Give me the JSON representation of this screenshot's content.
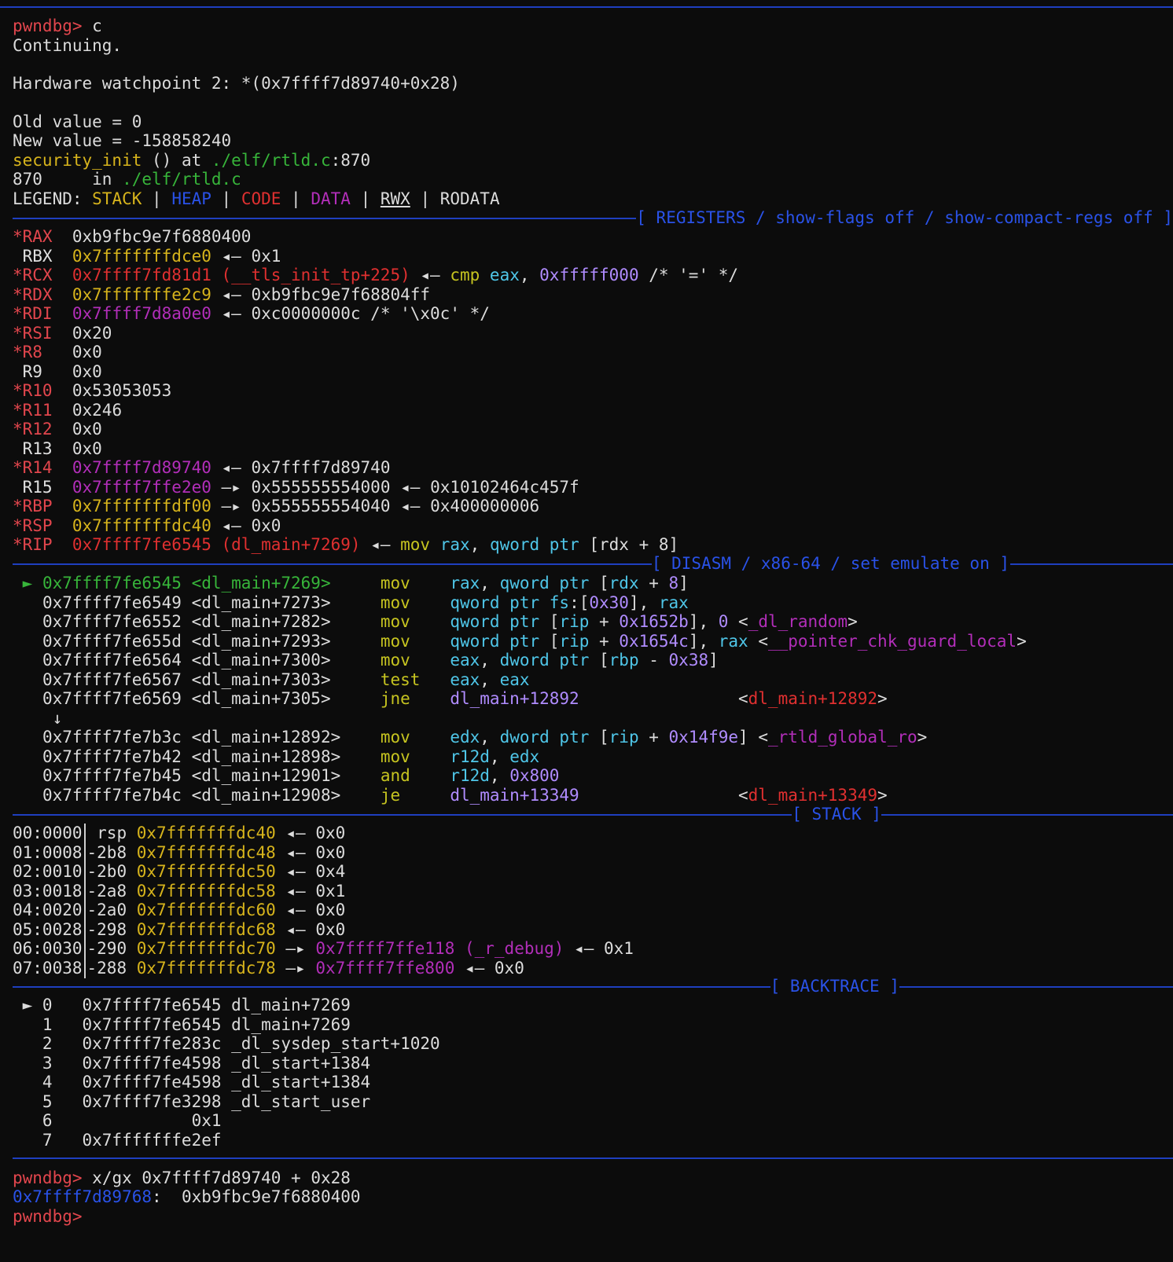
{
  "prompt": "pwndbg>",
  "session": {
    "cmd1": "c",
    "continuing": "Continuing.",
    "watch": "Hardware watchpoint 2: *(0x7ffff7d89740+0x28)",
    "old_value": "Old value = 0",
    "new_value": "New value = -158858240",
    "func": "security_init",
    "func_mid": " () at ",
    "file": "./elf/rtld.c",
    "file_line": ":870",
    "src_line_no": "870     in ",
    "legend": {
      "label": "LEGEND: ",
      "stack": "STACK",
      "heap": "HEAP",
      "code": "CODE",
      "data": "DATA",
      "rwx": "RWX",
      "rodata": "RODATA",
      "sep": " | "
    }
  },
  "headers": {
    "registers": "[ REGISTERS / show-flags off / show-compact-regs off ]",
    "disasm": "[ DISASM / x86-64 / set emulate on ]",
    "stack": "[ STACK ]",
    "backtrace": "[ BACKTRACE ]"
  },
  "registers": {
    "rax": {
      "name": "*RAX",
      "val": "0xb9fbc9e7f6880400"
    },
    "rbx": {
      "name": " RBX",
      "val": "0x7fffffffdce0",
      "arrow": " ◂— ",
      "deref": "0x1"
    },
    "rcx": {
      "name": "*RCX",
      "val": "0x7ffff7fd81d1 (__tls_init_tp+225)",
      "arrow": " ◂— ",
      "ins": "cmp",
      "a1": "eax",
      "a2": "0xfffff000",
      "cmt": " /* '=' */"
    },
    "rdx": {
      "name": "*RDX",
      "val": "0x7fffffffe2c9",
      "arrow": " ◂— ",
      "deref": "0xb9fbc9e7f68804ff"
    },
    "rdi": {
      "name": "*RDI",
      "val": "0x7ffff7d8a0e0",
      "arrow": " ◂— ",
      "deref": "0xc0000000c /* '\\x0c' */"
    },
    "rsi": {
      "name": "*RSI",
      "val": "0x20"
    },
    "r8": {
      "name": "*R8",
      "val": "0x0"
    },
    "r9": {
      "name": " R9",
      "val": "0x0"
    },
    "r10": {
      "name": "*R10",
      "val": "0x53053053"
    },
    "r11": {
      "name": "*R11",
      "val": "0x246"
    },
    "r12": {
      "name": "*R12",
      "val": "0x0"
    },
    "r13": {
      "name": " R13",
      "val": "0x0"
    },
    "r14": {
      "name": "*R14",
      "val": "0x7ffff7d89740",
      "arrow": " ◂— ",
      "deref": "0x7ffff7d89740"
    },
    "r15": {
      "name": " R15",
      "val": "0x7ffff7ffe2e0",
      "arrow": " —▸ ",
      "deref": "0x555555554000",
      "arrow2": " ◂— ",
      "deref2": "0x10102464c457f"
    },
    "rbp": {
      "name": "*RBP",
      "val": "0x7fffffffdf00",
      "arrow": " —▸ ",
      "deref": "0x555555554040",
      "arrow2": " ◂— ",
      "deref2": "0x400000006"
    },
    "rsp": {
      "name": "*RSP",
      "val": "0x7fffffffdc40",
      "arrow": " ◂— ",
      "deref": "0x0"
    },
    "rip": {
      "name": "*RIP",
      "val": "0x7ffff7fe6545 (dl_main+7269)",
      "arrow": " ◂— ",
      "ins": "mov",
      "a1": "rax",
      "a2": "qword ptr",
      "a3": " [rdx + 8]"
    }
  },
  "disasm": [
    {
      "marker": " ► ",
      "addr": "0x7ffff7fe6545 <dl_main+7269>",
      "mn": "mov",
      "ops": "rax, qword ptr [rdx + 8]"
    },
    {
      "marker": "   ",
      "addr": "0x7ffff7fe6549 <dl_main+7273>",
      "mn": "mov",
      "ops": "qword ptr fs:[0x30], rax"
    },
    {
      "marker": "   ",
      "addr": "0x7ffff7fe6552 <dl_main+7282>",
      "mn": "mov",
      "ops": "qword ptr [rip + 0x1652b], 0",
      "sym": "<_dl_random>"
    },
    {
      "marker": "   ",
      "addr": "0x7ffff7fe655d <dl_main+7293>",
      "mn": "mov",
      "ops": "qword ptr [rip + 0x1654c], rax",
      "sym": "<__pointer_chk_guard_local>"
    },
    {
      "marker": "   ",
      "addr": "0x7ffff7fe6564 <dl_main+7300>",
      "mn": "mov",
      "ops": "eax, dword ptr [rbp - 0x38]"
    },
    {
      "marker": "   ",
      "addr": "0x7ffff7fe6567 <dl_main+7303>",
      "mn": "test",
      "ops": "eax, eax"
    },
    {
      "marker": "   ",
      "addr": "0x7ffff7fe6569 <dl_main+7305>",
      "mn": "jne",
      "ops": "dl_main+12892",
      "sym": "<dl_main+12892>"
    },
    {
      "marker": "    ↓",
      "addr": "",
      "mn": "",
      "ops": ""
    },
    {
      "marker": "   ",
      "addr": "0x7ffff7fe7b3c <dl_main+12892>",
      "mn": "mov",
      "ops": "edx, dword ptr [rip + 0x14f9e]",
      "sym": "<_rtld_global_ro>"
    },
    {
      "marker": "   ",
      "addr": "0x7ffff7fe7b42 <dl_main+12898>",
      "mn": "mov",
      "ops": "r12d, edx"
    },
    {
      "marker": "   ",
      "addr": "0x7ffff7fe7b45 <dl_main+12901>",
      "mn": "and",
      "ops": "r12d, 0x800"
    },
    {
      "marker": "   ",
      "addr": "0x7ffff7fe7b4c <dl_main+12908>",
      "mn": "je",
      "ops": "dl_main+13349",
      "sym": "<dl_main+13349>"
    }
  ],
  "stack": [
    {
      "idx": "00:0000",
      "off": " rsp",
      "addr": "0x7fffffffdc40",
      "arrow": " ◂— ",
      "val": "0x0"
    },
    {
      "idx": "01:0008",
      "off": "-2b8",
      "addr": "0x7fffffffdc48",
      "arrow": " ◂— ",
      "val": "0x0"
    },
    {
      "idx": "02:0010",
      "off": "-2b0",
      "addr": "0x7fffffffdc50",
      "arrow": " ◂— ",
      "val": "0x4"
    },
    {
      "idx": "03:0018",
      "off": "-2a8",
      "addr": "0x7fffffffdc58",
      "arrow": " ◂— ",
      "val": "0x1"
    },
    {
      "idx": "04:0020",
      "off": "-2a0",
      "addr": "0x7fffffffdc60",
      "arrow": " ◂— ",
      "val": "0x0"
    },
    {
      "idx": "05:0028",
      "off": "-298",
      "addr": "0x7fffffffdc68",
      "arrow": " ◂— ",
      "val": "0x0"
    },
    {
      "idx": "06:0030",
      "off": "-290",
      "addr": "0x7fffffffdc70",
      "arrow": " —▸ ",
      "ptr": "0x7ffff7ffe118 (_r_debug)",
      "arrow2": " ◂— ",
      "val": "0x1"
    },
    {
      "idx": "07:0038",
      "off": "-288",
      "addr": "0x7fffffffdc78",
      "arrow": " —▸ ",
      "ptr": "0x7ffff7ffe800",
      "arrow2": " ◂— ",
      "val": "0x0"
    }
  ],
  "backtrace": [
    " ► 0   0x7ffff7fe6545 dl_main+7269",
    "   1   0x7ffff7fe6545 dl_main+7269",
    "   2   0x7ffff7fe283c _dl_sysdep_start+1020",
    "   3   0x7ffff7fe4598 _dl_start+1384",
    "   4   0x7ffff7fe4598 _dl_start+1384",
    "   5   0x7ffff7fe3298 _dl_start_user",
    "   6              0x1",
    "   7   0x7fffffffe2ef"
  ],
  "tail": {
    "cmd2": "x/gx 0x7ffff7d89740 + 0x28",
    "out_addr": "0x7ffff7d89768",
    "out_val": ":  0xb9fbc9e7f6880400"
  },
  "colors": {
    "background": "#0c0c0c",
    "prompt": "#e2464d",
    "stack": "#d7b41c",
    "heap": "#2a52e8",
    "code": "#e03030",
    "data": "#b22eb9",
    "current": "#37b53a",
    "separator": "#1f3fbf"
  }
}
